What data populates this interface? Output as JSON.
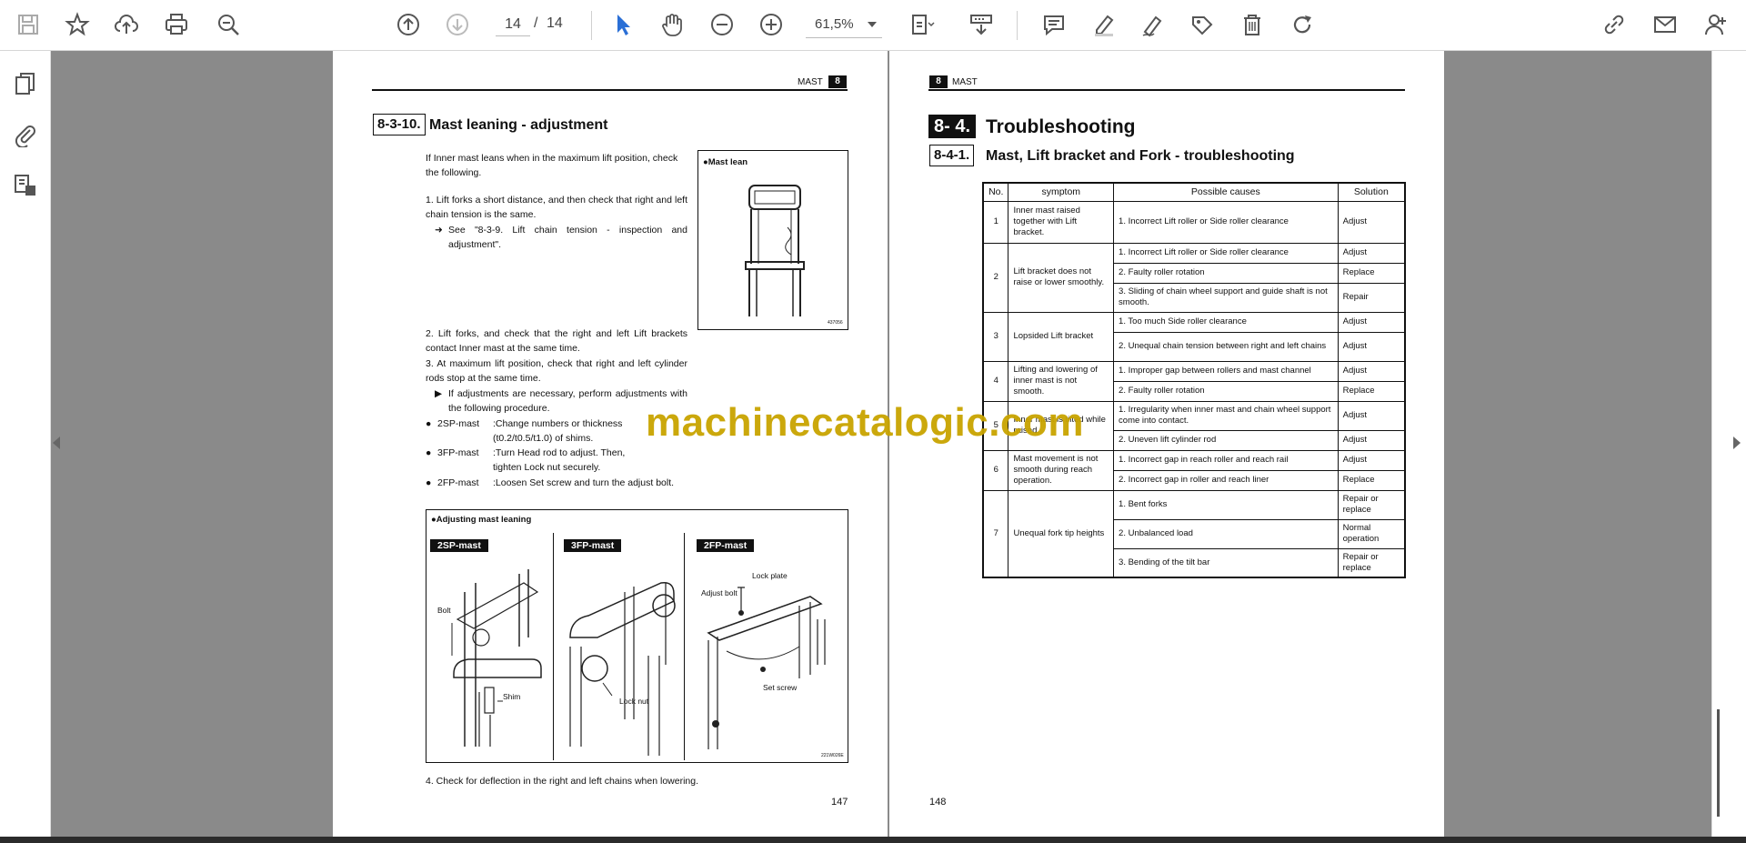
{
  "toolbar": {
    "page_current": "14",
    "page_separator": "/",
    "page_total": "14",
    "zoom": "61,5%"
  },
  "left_page": {
    "header": {
      "title": "MAST",
      "chapter": "8"
    },
    "section_number": "8-3-10.",
    "section_title": "Mast leaning - adjustment",
    "intro": "If Inner mast leans when in the maximum lift position, check the following.",
    "step1": "1. Lift forks a short distance, and then check that right and left chain tension is the same.",
    "step1_ref_arrow": "➜",
    "step1_ref": "See \"8-3-9. Lift chain tension - inspection and adjustment\".",
    "fig_mast_lean_label": "●Mast lean",
    "fig_mast_lean_code": "437056",
    "step2": "2. Lift forks, and check that the right and left Lift brackets contact Inner mast at the same time.",
    "step3": "3. At maximum lift position, check that right and left cylinder rods stop at the same time.",
    "step3_note_arrow": "▶",
    "step3_note": "If adjustments are necessary, perform adjustments with the following procedure.",
    "bullets": [
      {
        "mark": "●",
        "name": "2SP-mast",
        "text": ":Change numbers or thickness (t0.2/t0.5/t1.0) of shims."
      },
      {
        "mark": "●",
        "name": "3FP-mast",
        "text": ":Turn Head rod to adjust. Then, tighten Lock nut securely."
      },
      {
        "mark": "●",
        "name": "2FP-mast",
        "text": ":Loosen Set screw and turn the adjust bolt."
      }
    ],
    "fig_adjust_label": "●Adjusting mast leaning",
    "fig_adjust_tags": [
      "2SP-mast",
      "3FP-mast",
      "2FP-mast"
    ],
    "fig_callouts": {
      "bolt": "Bolt",
      "shim": "Shim",
      "lock_nut": "Lock nut",
      "lock_plate": "Lock plate",
      "adjust_bolt": "Adjust bolt",
      "set_screw": "Set screw"
    },
    "fig_adjust_code": "221W026E",
    "step4": "4. Check for deflection in the right and left chains when lowering.",
    "page_number": "147"
  },
  "right_page": {
    "header": {
      "title": "MAST",
      "chapter": "8"
    },
    "big_section_number": "8- 4.",
    "big_section_title": "Troubleshooting",
    "section_number": "8-4-1.",
    "section_title": "Mast, Lift bracket and Fork - troubleshooting",
    "table": {
      "headers": [
        "No.",
        "symptom",
        "Possible causes",
        "Solution"
      ],
      "groups": [
        {
          "no": "1",
          "symptom": "Inner mast raised together with Lift bracket.",
          "rows": [
            {
              "cause": "1. Incorrect Lift roller or Side roller clearance",
              "solution": "Adjust"
            }
          ]
        },
        {
          "no": "2",
          "symptom": "Lift bracket does not raise or lower smoothly.",
          "rows": [
            {
              "cause": "1. Incorrect Lift roller or Side roller clearance",
              "solution": "Adjust"
            },
            {
              "cause": "2. Faulty roller rotation",
              "solution": "Replace"
            },
            {
              "cause": "3. Sliding of chain wheel support and guide shaft is not smooth.",
              "solution": "Repair"
            }
          ]
        },
        {
          "no": "3",
          "symptom": "Lopsided Lift bracket",
          "rows": [
            {
              "cause": "1. Too much Side roller clearance",
              "solution": "Adjust"
            },
            {
              "cause": "2. Unequal chain tension between right and left chains",
              "solution": "Adjust"
            }
          ]
        },
        {
          "no": "4",
          "symptom": "Lifting and lowering of inner mast is not smooth.",
          "rows": [
            {
              "cause": "1. Improper gap between rollers and mast channel",
              "solution": "Adjust"
            },
            {
              "cause": "2. Faulty roller rotation",
              "solution": "Replace"
            }
          ]
        },
        {
          "no": "5",
          "symptom": "Inner mast is tilted while raised.",
          "rows": [
            {
              "cause": "1. Irregularity when inner mast and chain wheel support come into contact.",
              "solution": "Adjust"
            },
            {
              "cause": "2. Uneven lift cylinder rod",
              "solution": "Adjust"
            }
          ]
        },
        {
          "no": "6",
          "symptom": "Mast movement is not smooth during reach operation.",
          "rows": [
            {
              "cause": "1. Incorrect gap in reach roller and reach rail",
              "solution": "Adjust"
            },
            {
              "cause": "2. Incorrect gap in roller and reach liner",
              "solution": "Replace"
            }
          ]
        },
        {
          "no": "7",
          "symptom": "Unequal fork tip heights",
          "rows": [
            {
              "cause": "1. Bent forks",
              "solution": "Repair or replace"
            },
            {
              "cause": "2. Unbalanced load",
              "solution": "Normal operation"
            },
            {
              "cause": "3. Bending of the tilt bar",
              "solution": "Repair or replace"
            }
          ]
        }
      ]
    },
    "page_number": "148"
  },
  "watermark": "machinecatalogic.com",
  "icons": {
    "toolbar": [
      "save-icon",
      "bookmark-star-icon",
      "upload-cloud-icon",
      "print-icon",
      "zoom-search-icon",
      "prev-page-icon",
      "next-page-icon",
      "select-cursor-icon",
      "hand-tool-icon",
      "zoom-out-icon",
      "zoom-in-icon",
      "fit-page-icon",
      "scroll-mode-icon",
      "comment-icon",
      "highlight-pen-icon",
      "draw-icon",
      "stamp-icon",
      "delete-icon",
      "rotate-icon",
      "share-link-icon",
      "email-icon",
      "add-user-icon"
    ],
    "sidebar": [
      "pages-icon",
      "attachments-icon",
      "file-info-icon"
    ]
  },
  "colors": {
    "accent_blue": "#2a6fd6",
    "icon_gray": "#555555",
    "watermark": "#c9a400",
    "viewer_bg": "#8a8a8a"
  }
}
